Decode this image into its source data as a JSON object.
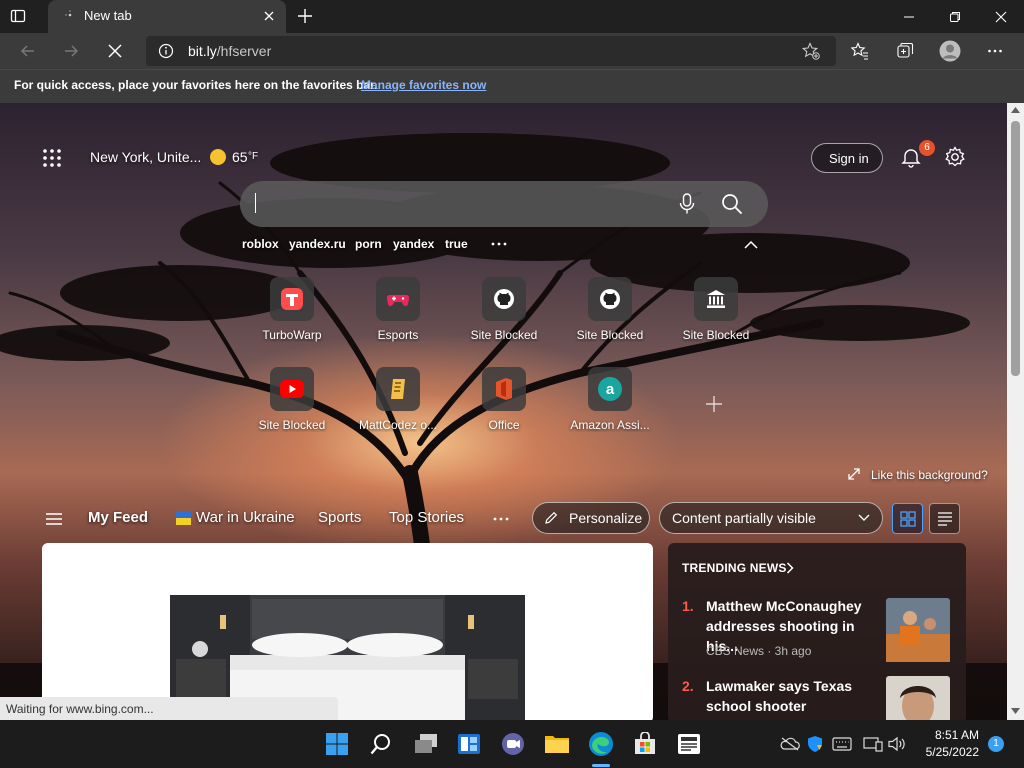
{
  "browser": {
    "tab_title": "New tab",
    "address_host": "bit.ly",
    "address_path": "/hfserver",
    "favorites_bar_text": "For quick access, place your favorites here on the favorites bar.",
    "favorites_bar_link": "Manage favorites now"
  },
  "newtab": {
    "location": "New York, Unite...",
    "temperature": "65",
    "temp_unit": "°F",
    "sign_in": "Sign in",
    "notification_count": "6",
    "search_placeholder": "",
    "suggestions": [
      "roblox",
      "yandex.ru",
      "porn",
      "yandex",
      "true"
    ],
    "tiles": [
      {
        "label": "TurboWarp",
        "icon": "turbowarp-icon"
      },
      {
        "label": "Esports",
        "icon": "gamepad-icon"
      },
      {
        "label": "Site Blocked",
        "icon": "github-icon"
      },
      {
        "label": "Site Blocked",
        "icon": "github-icon"
      },
      {
        "label": "Site Blocked",
        "icon": "bank-icon"
      },
      {
        "label": "Site Blocked",
        "icon": "youtube-icon"
      },
      {
        "label": "MattCodez o...",
        "icon": "mattcodez-icon"
      },
      {
        "label": "Office",
        "icon": "office-icon"
      },
      {
        "label": "Amazon Assi...",
        "icon": "amazon-icon"
      }
    ],
    "like_background": "Like this background?",
    "feed_tabs": {
      "my_feed": "My Feed",
      "ukraine": "War in Ukraine",
      "sports": "Sports",
      "top_stories": "Top Stories"
    },
    "personalize": "Personalize",
    "content_visibility": "Content partially visible",
    "trending": {
      "header": "TRENDING NEWS",
      "items": [
        {
          "rank": "1.",
          "headline": "Matthew McConaughey addresses shooting in his...",
          "source": "CBS News · 3h ago"
        },
        {
          "rank": "2.",
          "headline": "Lawmaker says Texas school shooter originally...",
          "source": ""
        }
      ]
    }
  },
  "status": "Waiting for www.bing.com...",
  "taskbar": {
    "time": "8:51 AM",
    "date": "5/25/2022",
    "notification_badge": "1"
  },
  "colors": {
    "accent_blue": "#0078d4",
    "rank_red": "#ff5a4a",
    "link_blue": "#8ab4f8"
  }
}
